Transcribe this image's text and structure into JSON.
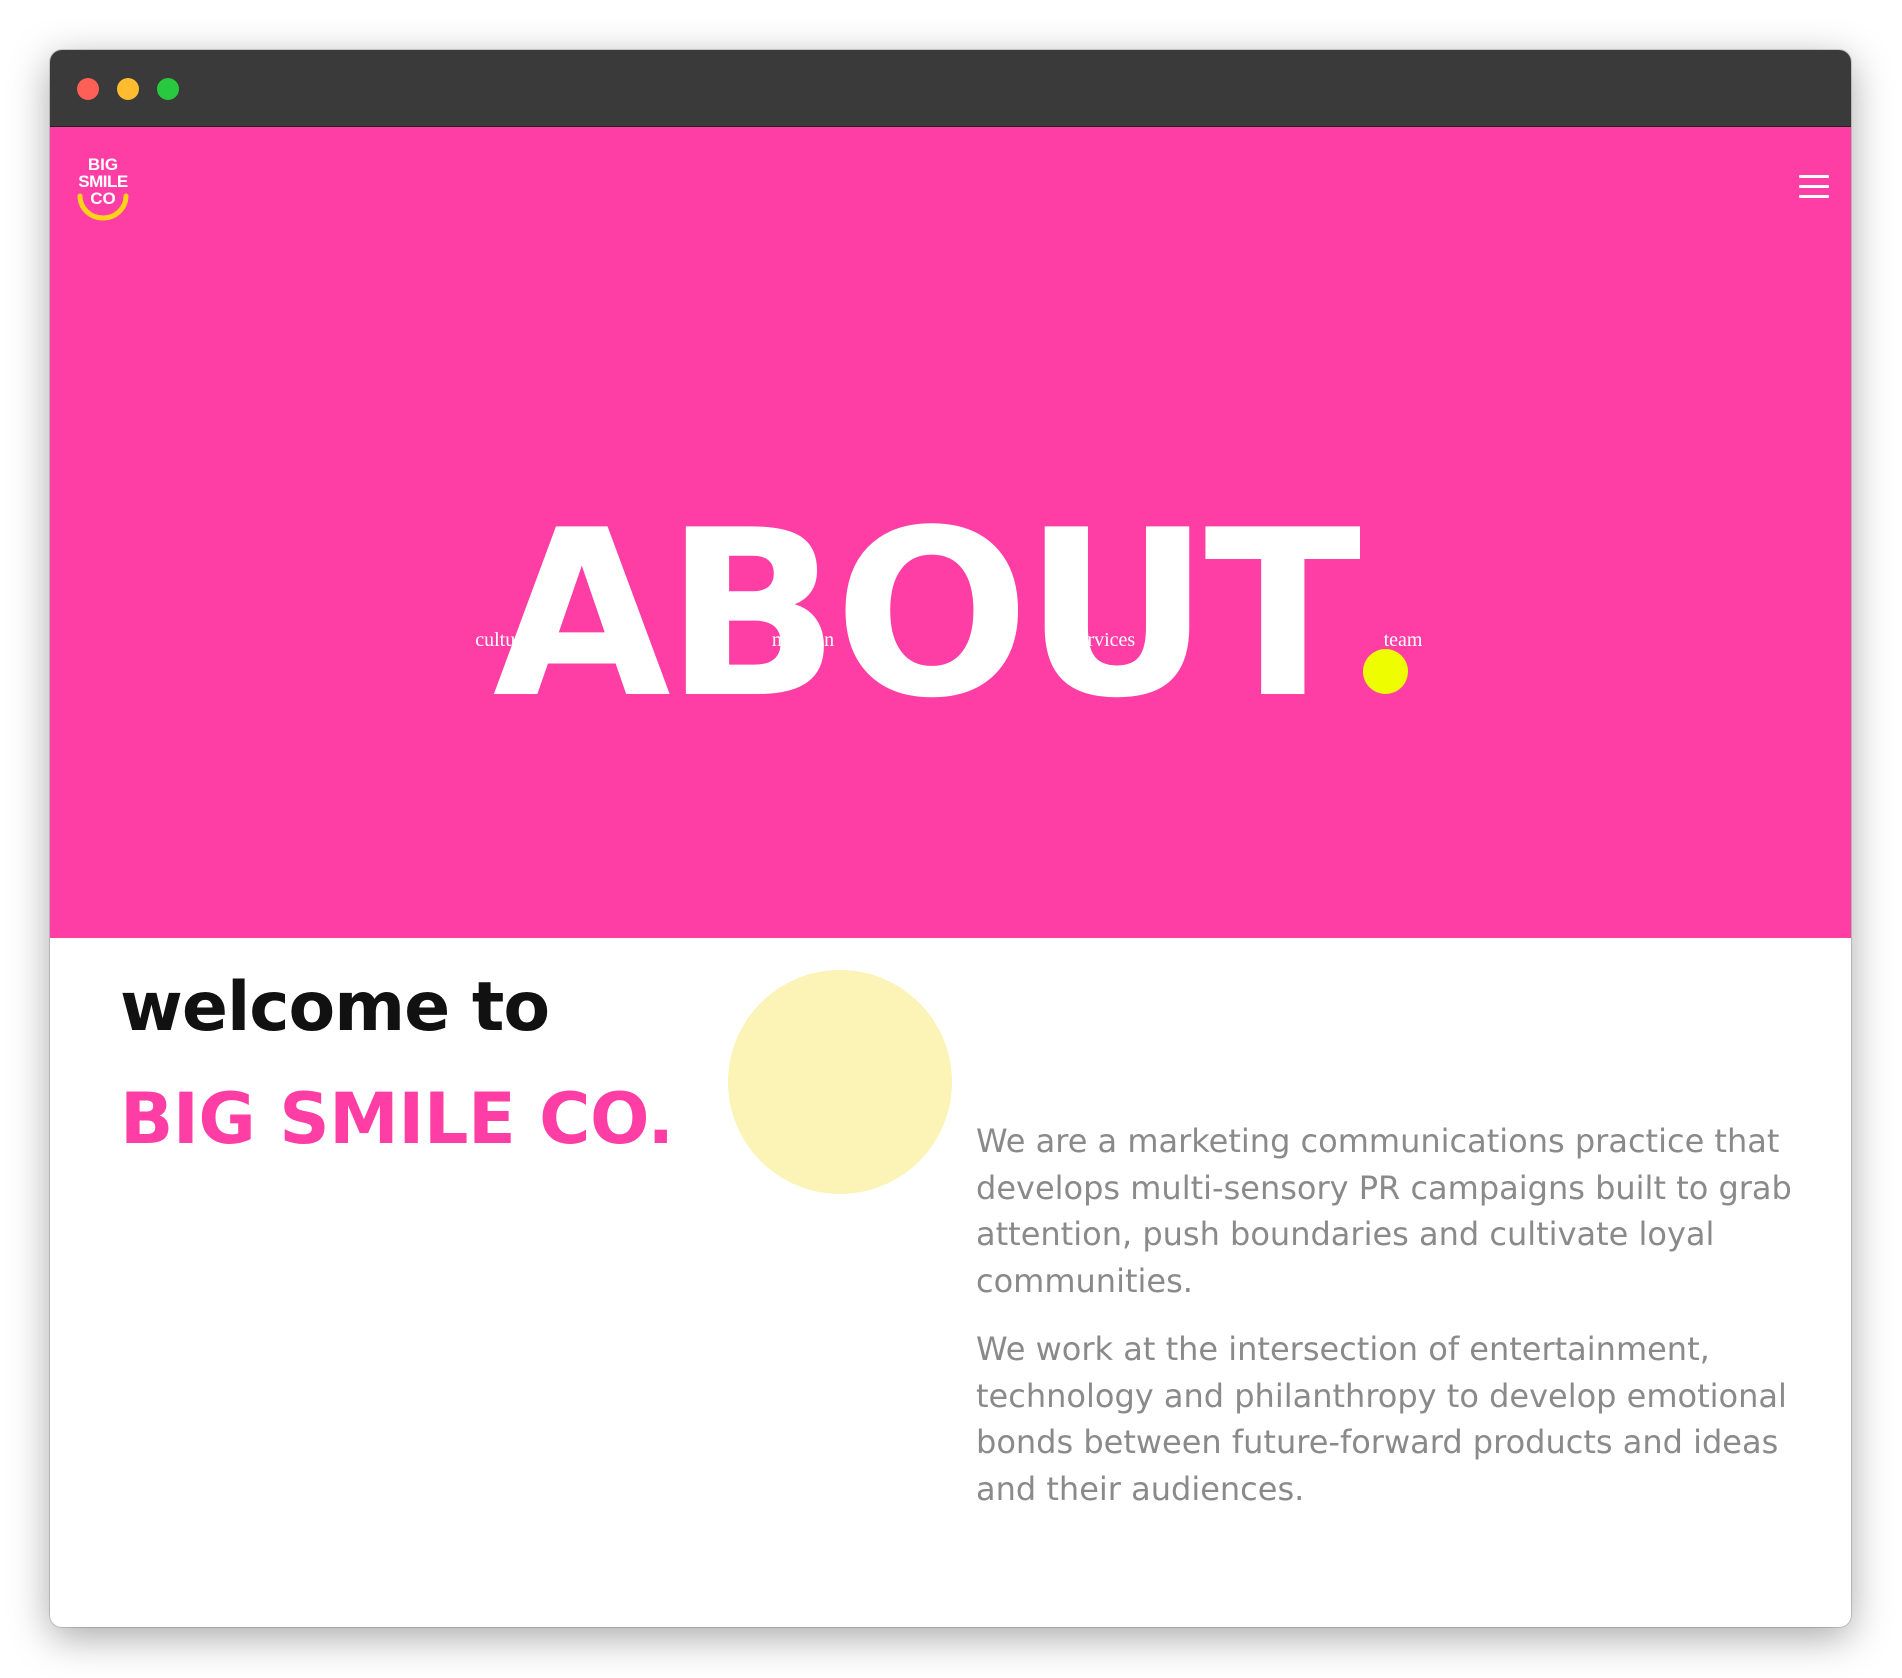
{
  "logo": {
    "line1": "BIG",
    "line2": "SMILE",
    "line3": "CO"
  },
  "menu_icon": "hamburger-menu-icon",
  "hero": {
    "title": "ABOUT",
    "background": "#ff3ea5",
    "dot_color": "#eefe00",
    "nav": [
      "culture",
      "mission",
      "services",
      "team"
    ]
  },
  "intro": {
    "welcome": "welcome to",
    "brand": "BIG SMILE CO.",
    "paragraphs": [
      "We are a marketing communications practice that develops multi-sensory PR campaigns built to grab attention, push boundaries and cultivate loyal communities.",
      "We work at the intersection of entertainment, technology and philanthropy to develop emotional bonds between future-forward products and ideas and their audiences."
    ]
  },
  "window_controls": {
    "close": "#fe5f57",
    "minimize": "#febc2e",
    "maximize": "#28c840"
  }
}
